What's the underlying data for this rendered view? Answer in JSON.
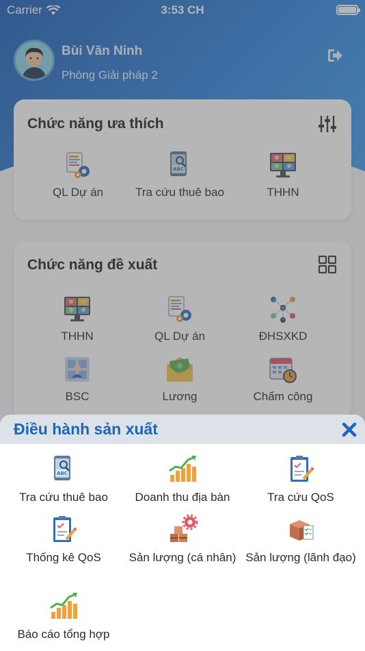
{
  "status_bar": {
    "carrier": "Carrier",
    "time": "3:53 CH"
  },
  "profile": {
    "name": "Bùi Văn Ninh",
    "department": "Phòng Giải pháp 2"
  },
  "favorites": {
    "title": "Chức năng ưa thích",
    "items": [
      {
        "label": "QL Dự án",
        "icon": "project-management-icon"
      },
      {
        "label": "Tra cứu thuê bao",
        "icon": "subscriber-lookup-icon"
      },
      {
        "label": "THHN",
        "icon": "video-conference-icon"
      }
    ]
  },
  "suggested": {
    "title": "Chức năng đề xuất",
    "items": [
      {
        "label": "THHN",
        "icon": "video-conference-icon"
      },
      {
        "label": "QL Dự án",
        "icon": "project-management-icon"
      },
      {
        "label": "ĐHSXKD",
        "icon": "business-operations-icon"
      },
      {
        "label": "BSC",
        "icon": "bsc-icon"
      },
      {
        "label": "Lương",
        "icon": "salary-envelope-icon"
      },
      {
        "label": "Chấm công",
        "icon": "timekeeping-calendar-icon"
      }
    ]
  },
  "sheet": {
    "title": "Điều hành sản xuất",
    "items": [
      {
        "label": "Tra cứu thuê bao",
        "icon": "subscriber-lookup-icon"
      },
      {
        "label": "Doanh thu địa bàn",
        "icon": "revenue-chart-icon"
      },
      {
        "label": "Tra cứu QoS",
        "icon": "qos-clipboard-icon"
      },
      {
        "label": "Thống kê QoS",
        "icon": "qos-stats-clipboard-icon"
      },
      {
        "label": "Sản lượng (cá nhân)",
        "icon": "personal-output-icon"
      },
      {
        "label": "Sản lượng (lãnh đạo)",
        "icon": "leader-output-icon"
      },
      {
        "label": "Báo cáo tổng hợp",
        "icon": "summary-report-icon"
      }
    ]
  },
  "colors": {
    "accent": "#1e66b8",
    "header_gradient_start": "#1f5fb8",
    "header_gradient_end": "#3f9ef0",
    "sheet_header": "#dde2e8"
  }
}
